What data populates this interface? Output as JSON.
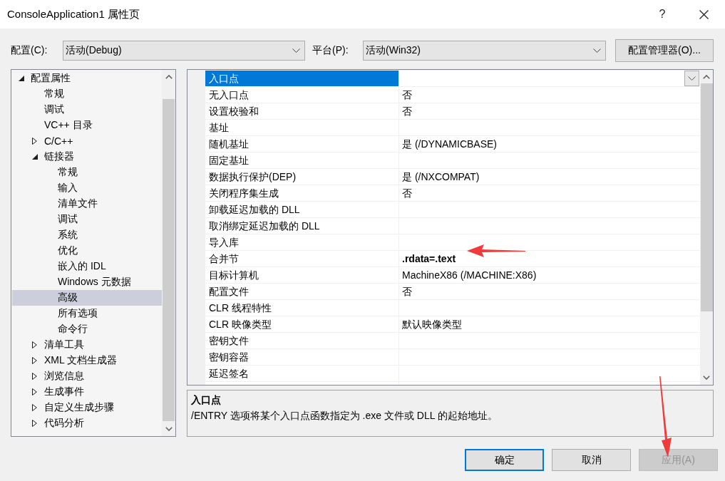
{
  "window": {
    "title": "ConsoleApplication1 属性页",
    "help": "?"
  },
  "toolbar": {
    "configuration": {
      "label": "配置(C):",
      "value": "活动(Debug)"
    },
    "platform": {
      "label": "平台(P):",
      "value": "活动(Win32)"
    },
    "manager_button": "配置管理器(O)..."
  },
  "tree": {
    "items": [
      {
        "label": "配置属性",
        "expanded": true,
        "selected": false,
        "children": [
          {
            "label": "常规",
            "selected": false
          },
          {
            "label": "调试",
            "selected": false
          },
          {
            "label": "VC++ 目录",
            "selected": false
          },
          {
            "label": "C/C++",
            "expanded": false,
            "selected": false
          },
          {
            "label": "链接器",
            "expanded": true,
            "selected": false,
            "children": [
              {
                "label": "常规",
                "selected": false
              },
              {
                "label": "输入",
                "selected": false
              },
              {
                "label": "清单文件",
                "selected": false
              },
              {
                "label": "调试",
                "selected": false
              },
              {
                "label": "系统",
                "selected": false
              },
              {
                "label": "优化",
                "selected": false
              },
              {
                "label": "嵌入的 IDL",
                "selected": false
              },
              {
                "label": "Windows 元数据",
                "selected": false
              },
              {
                "label": "高级",
                "selected": true
              },
              {
                "label": "所有选项",
                "selected": false
              },
              {
                "label": "命令行",
                "selected": false
              }
            ]
          },
          {
            "label": "清单工具",
            "expanded": false,
            "selected": false
          },
          {
            "label": "XML 文档生成器",
            "expanded": false,
            "selected": false
          },
          {
            "label": "浏览信息",
            "expanded": false,
            "selected": false
          },
          {
            "label": "生成事件",
            "expanded": false,
            "selected": false
          },
          {
            "label": "自定义生成步骤",
            "expanded": false,
            "selected": false
          },
          {
            "label": "代码分析",
            "expanded": false,
            "selected": false
          }
        ]
      }
    ]
  },
  "grid": {
    "rows": [
      {
        "name": "入口点",
        "selected": true
      },
      {
        "name": "无入口点",
        "value": "否",
        "selected": false,
        "modified": false
      },
      {
        "name": "设置校验和",
        "value": "否",
        "selected": false,
        "modified": false
      },
      {
        "name": "基址",
        "selected": false
      },
      {
        "name": "随机基址",
        "value": "是 (/DYNAMICBASE)",
        "selected": false,
        "modified": false
      },
      {
        "name": "固定基址",
        "selected": false
      },
      {
        "name": "数据执行保护(DEP)",
        "value": "是 (/NXCOMPAT)",
        "selected": false,
        "modified": false
      },
      {
        "name": "关闭程序集生成",
        "value": "否",
        "selected": false,
        "modified": false
      },
      {
        "name": "卸载延迟加载的 DLL",
        "selected": false
      },
      {
        "name": "取消绑定延迟加载的 DLL",
        "selected": false
      },
      {
        "name": "导入库",
        "selected": false
      },
      {
        "name": "合并节",
        "value": ".rdata=.text",
        "selected": false,
        "modified": true
      },
      {
        "name": "目标计算机",
        "value": "MachineX86 (/MACHINE:X86)",
        "selected": false,
        "modified": false
      },
      {
        "name": "配置文件",
        "value": "否",
        "selected": false,
        "modified": false
      },
      {
        "name": "CLR 线程特性",
        "selected": false
      },
      {
        "name": "CLR 映像类型",
        "value": "默认映像类型",
        "selected": false,
        "modified": false
      },
      {
        "name": "密钥文件",
        "selected": false
      },
      {
        "name": "密钥容器",
        "selected": false
      },
      {
        "name": "延迟签名",
        "selected": false
      }
    ]
  },
  "description": {
    "title": "入口点",
    "text": "/ENTRY 选项将某个入口点函数指定为 .exe 文件或 DLL 的起始地址。"
  },
  "buttons": [
    {
      "label": "确定",
      "default": true,
      "disabled": false
    },
    {
      "label": "取消",
      "default": false,
      "disabled": false
    },
    {
      "label": "应用(A)",
      "default": false,
      "disabled": true
    }
  ]
}
